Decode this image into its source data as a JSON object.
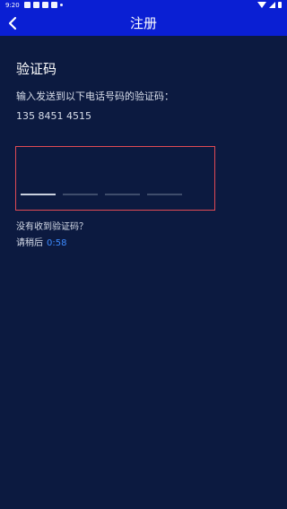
{
  "status_bar": {
    "time": "9:20"
  },
  "header": {
    "title": "注册"
  },
  "main": {
    "title": "验证码",
    "instruction": "输入发送到以下电话号码的验证码：",
    "phone_number": "135 8451 4515",
    "code_slots": [
      "",
      "",
      "",
      ""
    ],
    "no_code_text": "没有收到验证码？",
    "wait_text": "请稍后",
    "countdown": "0:58"
  },
  "colors": {
    "header_bg": "#0a1fd3",
    "page_bg": "#0c1a40",
    "input_border": "#e04a55",
    "countdown": "#3d8bff"
  }
}
